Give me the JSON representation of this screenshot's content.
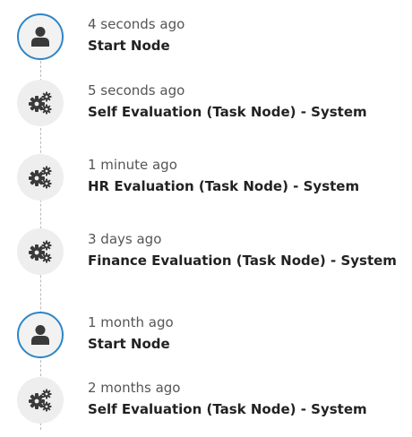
{
  "timeline": {
    "items": [
      {
        "time": "4 seconds ago",
        "title": "Start Node",
        "icon": "user-icon"
      },
      {
        "time": "5 seconds ago",
        "title": "Self Evaluation (Task Node) - System",
        "icon": "gears-icon"
      },
      {
        "time": "1 minute ago",
        "title": "HR Evaluation (Task Node) - System",
        "icon": "gears-icon"
      },
      {
        "time": "3 days ago",
        "title": "Finance Evaluation (Task Node) - System",
        "icon": "gears-icon"
      },
      {
        "time": "1 month ago",
        "title": "Start Node",
        "icon": "user-icon"
      },
      {
        "time": "2 months ago",
        "title": "Self Evaluation (Task Node) - System",
        "icon": "gears-icon"
      }
    ]
  },
  "colors": {
    "accent": "#2f86c6",
    "icon": "#3a3a3a",
    "circle_bg": "#eeeeee",
    "connector": "#b9b9b9"
  }
}
